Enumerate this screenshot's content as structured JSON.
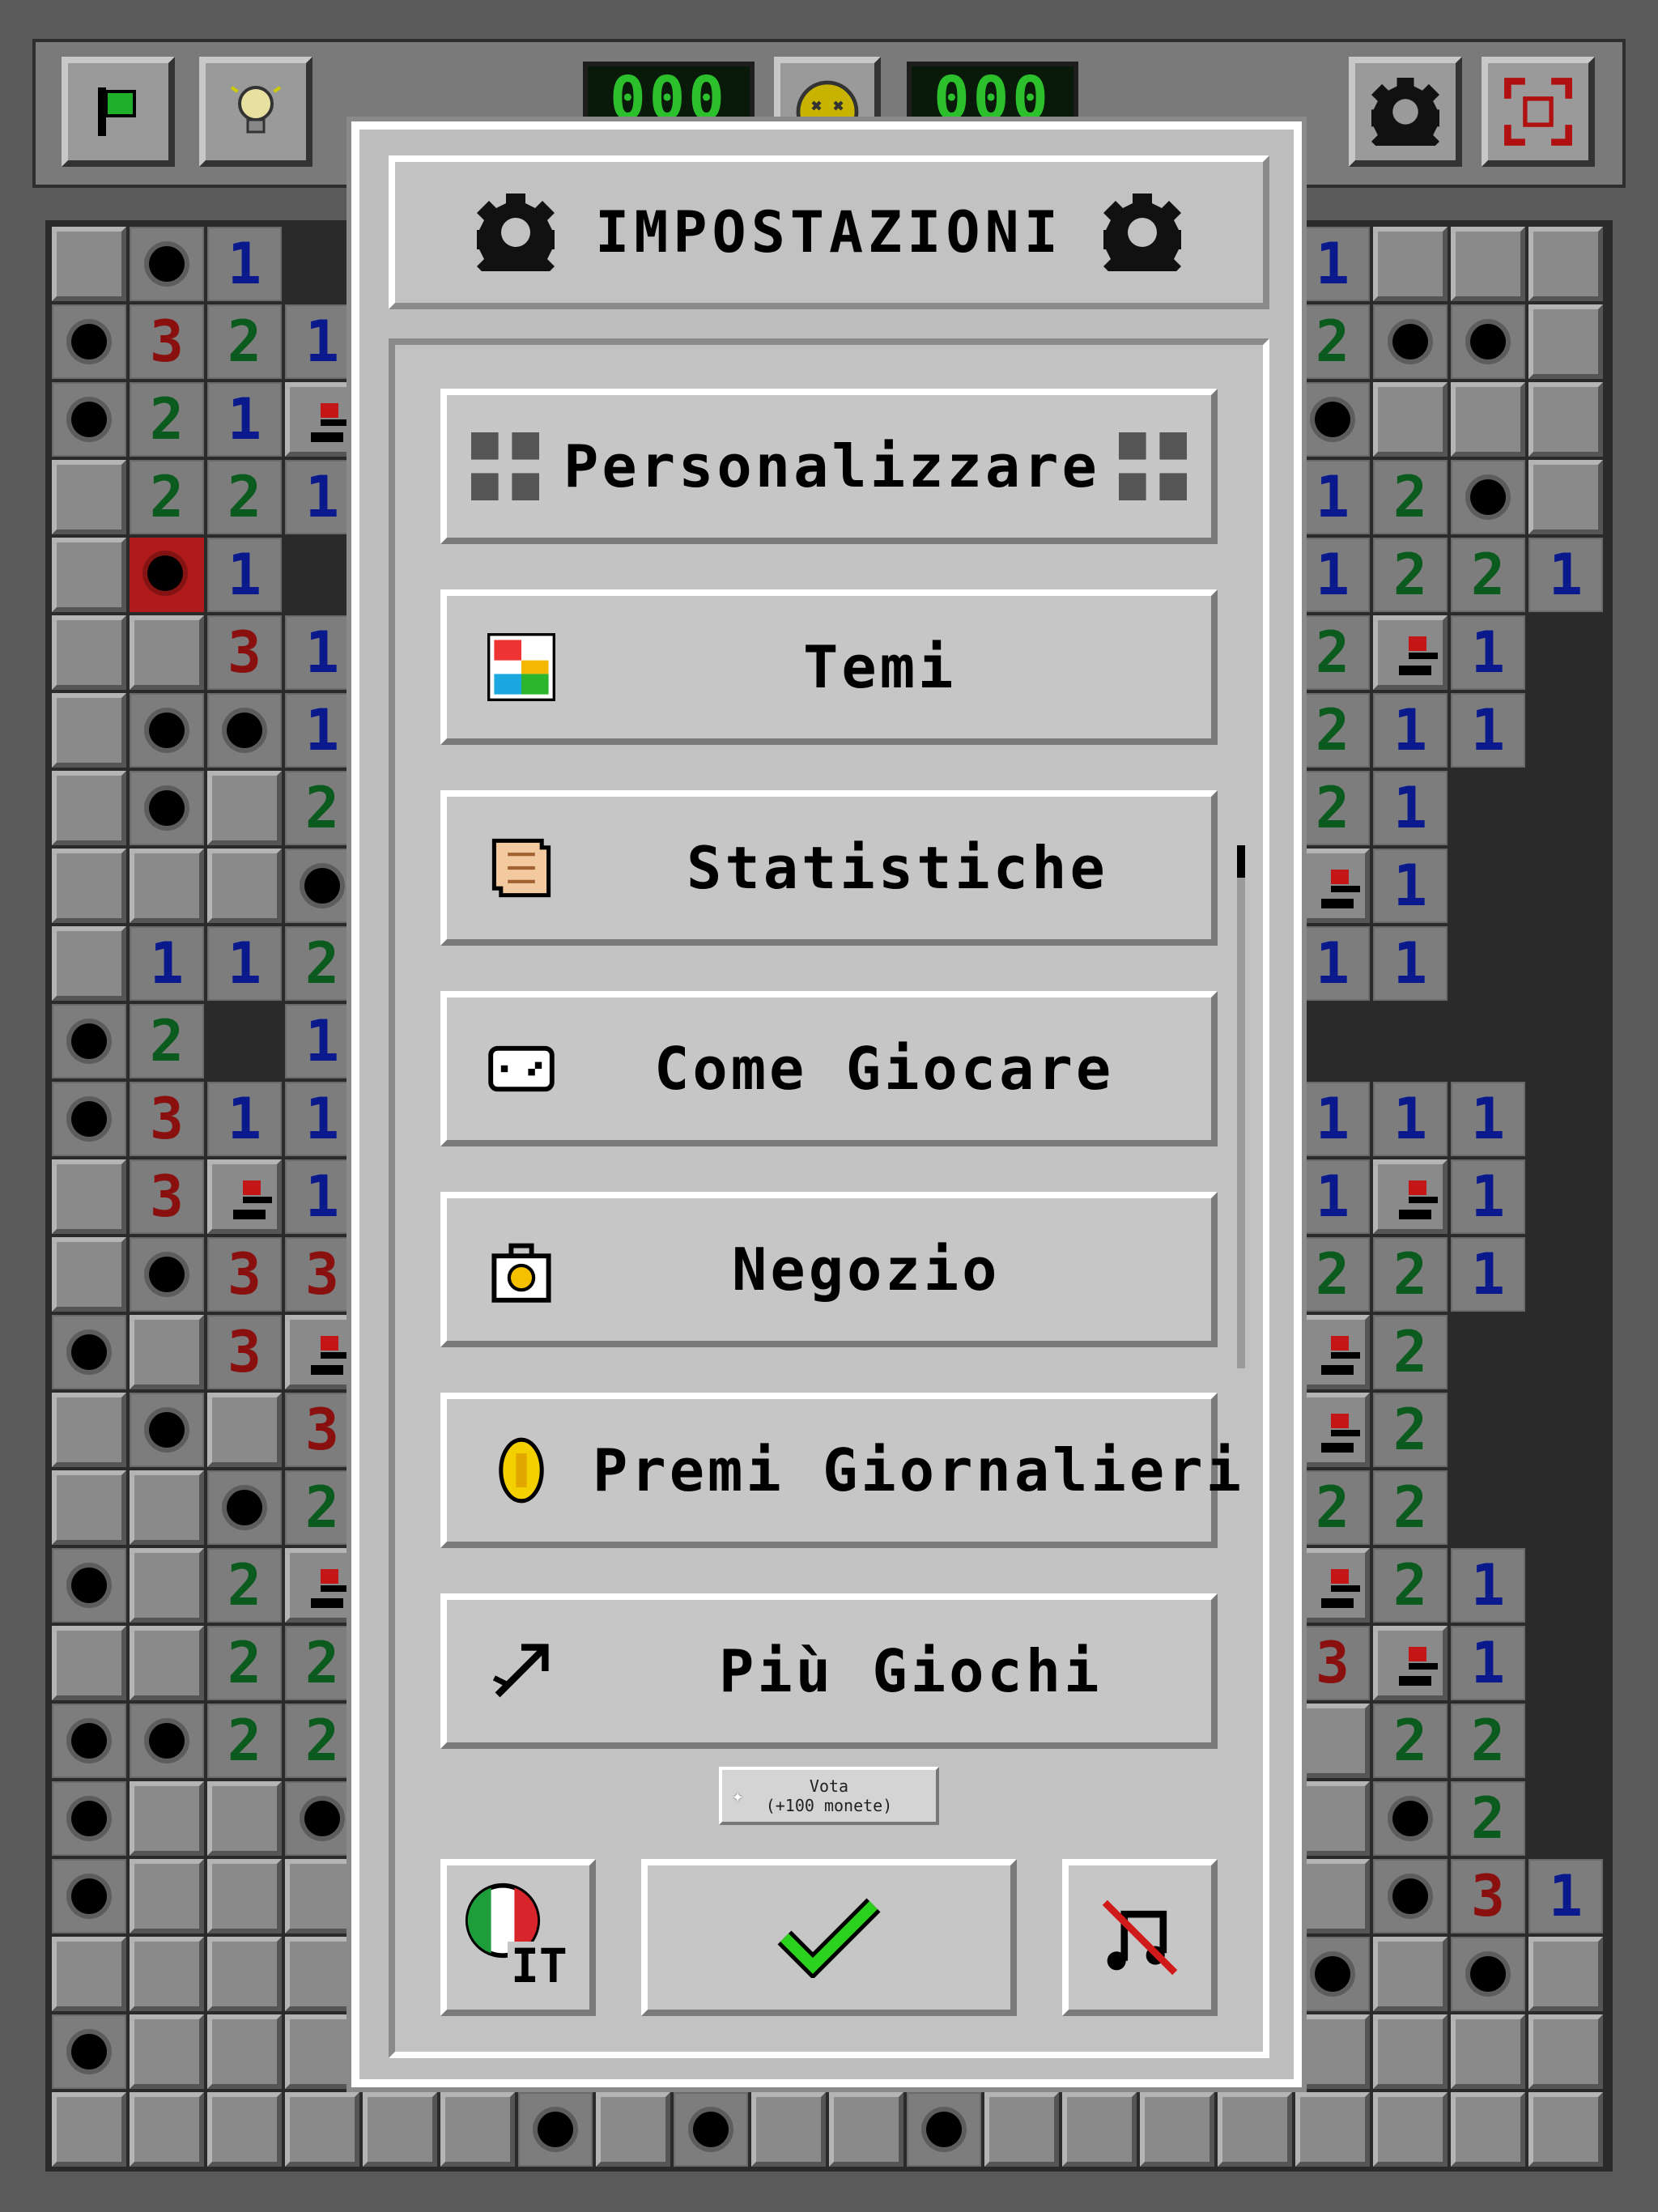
{
  "hud": {
    "mine_counter": "000",
    "timer": "000",
    "flag_label": "flag",
    "hint_label": "hint"
  },
  "settings": {
    "title": "IMPOSTAZIONI",
    "items": [
      {
        "label": "Personalizzare",
        "icon": "customize-grid-icon"
      },
      {
        "label": "Temi",
        "icon": "themes-palette-icon"
      },
      {
        "label": "Statistiche",
        "icon": "scroll-icon"
      },
      {
        "label": "Come Giocare",
        "icon": "gamepad-icon"
      },
      {
        "label": "Negozio",
        "icon": "shop-bag-icon"
      },
      {
        "label": "Premi Giornalieri",
        "icon": "coin-icon"
      },
      {
        "label": "Più Giochi",
        "icon": "arrow-icon"
      }
    ],
    "vote_line1": "Vota",
    "vote_line2": "(+100 monete)",
    "language_code": "IT",
    "confirm_icon": "checkmark-icon",
    "music_icon": "music-off-icon"
  },
  "colors": {
    "n1": "#0a1a8c",
    "n2": "#0b5a1e",
    "n3": "#8a1010",
    "lcd": "#2cc02c",
    "confirm": "#2ad21e"
  }
}
